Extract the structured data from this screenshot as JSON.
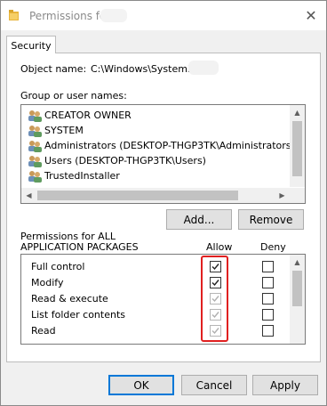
{
  "window": {
    "title": "Permissions for",
    "close_glyph": "✕",
    "tab_label": "Security"
  },
  "object": {
    "label": "Object name:",
    "value": "C:\\Windows\\System32\\"
  },
  "groups": {
    "label": "Group or user names:",
    "items": [
      {
        "label": "CREATOR OWNER",
        "icon": "users-icon"
      },
      {
        "label": "SYSTEM",
        "icon": "users-icon"
      },
      {
        "label": "Administrators (DESKTOP-THGP3TK\\Administrators)",
        "icon": "users-icon"
      },
      {
        "label": "Users (DESKTOP-THGP3TK\\Users)",
        "icon": "users-icon"
      },
      {
        "label": "TrustedInstaller",
        "icon": "users-icon"
      }
    ],
    "add_label": "Add...",
    "remove_label": "Remove"
  },
  "permissions": {
    "label_line1": "Permissions for ALL",
    "label_line2": "APPLICATION PACKAGES",
    "allow_header": "Allow",
    "deny_header": "Deny",
    "rows": [
      {
        "label": "Full control",
        "allow": true,
        "allow_enabled": true,
        "deny": false
      },
      {
        "label": "Modify",
        "allow": true,
        "allow_enabled": true,
        "deny": false
      },
      {
        "label": "Read & execute",
        "allow": true,
        "allow_enabled": false,
        "deny": false
      },
      {
        "label": "List folder contents",
        "allow": true,
        "allow_enabled": false,
        "deny": false
      },
      {
        "label": "Read",
        "allow": true,
        "allow_enabled": false,
        "deny": false
      }
    ]
  },
  "footer": {
    "ok_label": "OK",
    "cancel_label": "Cancel",
    "apply_label": "Apply"
  },
  "colors": {
    "highlight": "#e02020",
    "default_button_border": "#0078d7"
  }
}
